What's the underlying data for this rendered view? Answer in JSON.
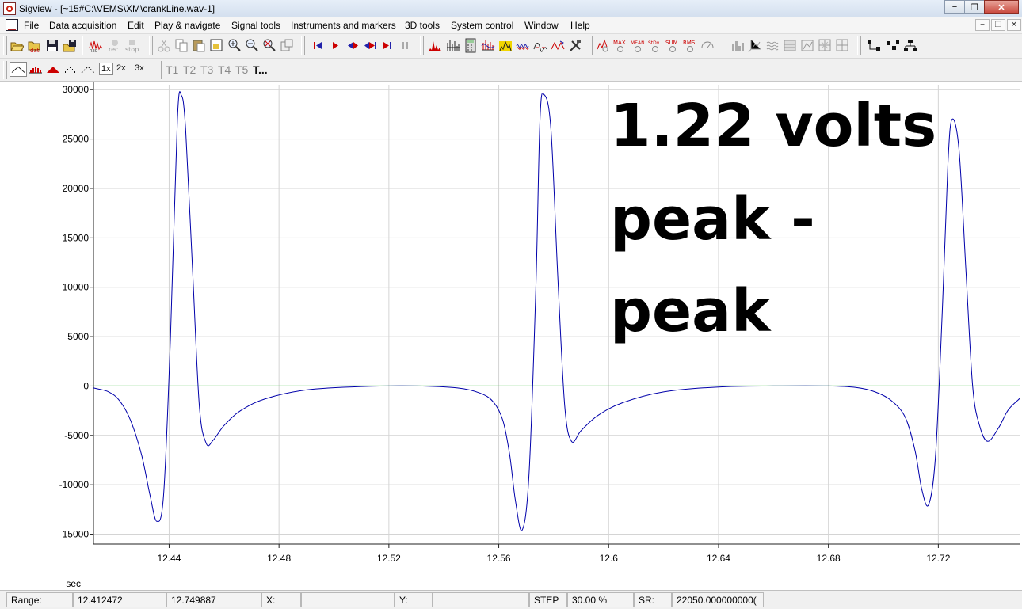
{
  "window": {
    "title": "Sigview - [~15#C:\\VEMS\\XM\\crankLine.wav-1]",
    "controls": [
      "−",
      "❐",
      "✕"
    ]
  },
  "menu": [
    "File",
    "Data acquisition",
    "Edit",
    "Play & navigate",
    "Signal tools",
    "Instruments and markers",
    "3D tools",
    "System control",
    "Window",
    "Help"
  ],
  "mdi_controls": [
    "−",
    "❐",
    "✕"
  ],
  "toolbar2": {
    "zoom": [
      "1x",
      "2x",
      "3x"
    ],
    "tabs": [
      "T1",
      "T2",
      "T3",
      "T4",
      "T5",
      "T..."
    ]
  },
  "annotation": {
    "line1": "1.22 volts",
    "line2": "peak -",
    "line3": "peak"
  },
  "status": {
    "range_label": "Range:",
    "range_start": "12.412472",
    "range_end": "12.749887",
    "x_label": "X:",
    "x_value": "",
    "y_label": "Y:",
    "y_value": "",
    "step_label": "STEP",
    "step_value": "30.00 %",
    "sr_label": "SR:",
    "sr_value": "22050.000000000("
  },
  "chart_data": {
    "type": "line",
    "xlabel": "sec",
    "ylabel": "",
    "xlim": [
      12.412472,
      12.749887
    ],
    "ylim": [
      -16000,
      30500
    ],
    "xticks": [
      12.44,
      12.48,
      12.52,
      12.56,
      12.6,
      12.64,
      12.68,
      12.72
    ],
    "xtick_labels": [
      "12.44",
      "12.48",
      "12.52",
      "12.56",
      "12.6",
      "12.64",
      "12.68",
      "12.72"
    ],
    "yticks": [
      30000,
      25000,
      20000,
      15000,
      10000,
      5000,
      0,
      -5000,
      -10000,
      -15000
    ],
    "ytick_labels": [
      "30000",
      "25000",
      "20000",
      "15000",
      "10000",
      "5000",
      "0",
      "-5000",
      "-10000",
      "-15000"
    ],
    "grid": true,
    "zero_line_color": "#22cc22",
    "series": [
      {
        "color": "#0000aa",
        "x": [
          12.4125,
          12.418,
          12.422,
          12.426,
          12.43,
          12.433,
          12.4355,
          12.438,
          12.4405,
          12.443,
          12.4445,
          12.446,
          12.4485,
          12.451,
          12.4535,
          12.456,
          12.46,
          12.466,
          12.475,
          12.49,
          12.51,
          12.53,
          12.545,
          12.553,
          12.558,
          12.5615,
          12.564,
          12.566,
          12.5685,
          12.571,
          12.5735,
          12.575,
          12.5765,
          12.579,
          12.5815,
          12.584,
          12.5865,
          12.59,
          12.596,
          12.605,
          12.62,
          12.64,
          12.66,
          12.68,
          12.69,
          12.697,
          12.703,
          12.708,
          12.7115,
          12.714,
          12.7165,
          12.719,
          12.7215,
          12.7235,
          12.725,
          12.7275,
          12.73,
          12.7325,
          12.735,
          12.738,
          12.742,
          12.7455,
          12.7499
        ],
        "y": [
          -200,
          -600,
          -1500,
          -3500,
          -7000,
          -11000,
          -13700,
          -11000,
          5000,
          27000,
          29400,
          26000,
          12000,
          -2000,
          -5800,
          -5500,
          -4000,
          -2500,
          -1300,
          -400,
          -50,
          0,
          -200,
          -700,
          -1600,
          -3500,
          -7000,
          -11500,
          -14600,
          -9000,
          10000,
          27000,
          29500,
          26000,
          11000,
          -2000,
          -5600,
          -4500,
          -3000,
          -1700,
          -600,
          -100,
          0,
          0,
          -150,
          -600,
          -1500,
          -3200,
          -6500,
          -10500,
          -12000,
          -7000,
          8000,
          22500,
          27000,
          24000,
          12000,
          0,
          -4000,
          -5600,
          -4200,
          -2400,
          -1200
        ]
      }
    ]
  }
}
